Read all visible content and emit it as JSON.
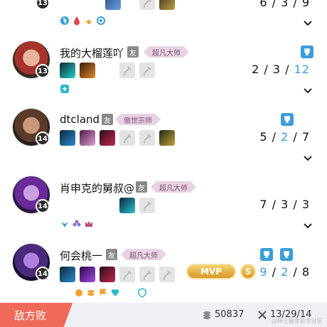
{
  "players": [
    {
      "level": "13",
      "kda": {
        "k": "6",
        "d": "3",
        "a": "9"
      },
      "rune_icons": [
        "lightning-rune-icon",
        "blood-rune-icon",
        "fire-rune-icon",
        "cog-rune-icon"
      ]
    },
    {
      "name": "我的大榴莲吖",
      "friend": "友",
      "rank": "超凡大师",
      "level": "13",
      "kda": {
        "k": "2",
        "d": "3",
        "a": "12"
      },
      "trophies": 1
    },
    {
      "name": "dtcland",
      "friend": "友",
      "rank": "傲世宗师",
      "level": "14",
      "kda": {
        "k": "5",
        "d": "2",
        "a": "7"
      },
      "trophies": 1
    },
    {
      "name": "肖申克的舅叔@",
      "friend": "友",
      "rank": "超凡大师",
      "level": "14",
      "kda": {
        "k": "7",
        "d": "3",
        "a": "3"
      }
    },
    {
      "name": "何会桃一",
      "friend": "友",
      "rank": "超凡大师",
      "level": "14",
      "kda": {
        "k": "9",
        "d": "2",
        "a": "8"
      },
      "mvp_label": "MVP",
      "svp_label": "S",
      "trophies": 2
    }
  ],
  "footer": {
    "result": "敌方败",
    "gold": "50837",
    "team_kda": "13/29/14",
    "watermark": "@稀土掘金技术社区"
  },
  "colors": {
    "accent_blue": "#3a9ed9",
    "defeat_red": "#f06a5a",
    "rank_pink": "#e8d3e3"
  }
}
